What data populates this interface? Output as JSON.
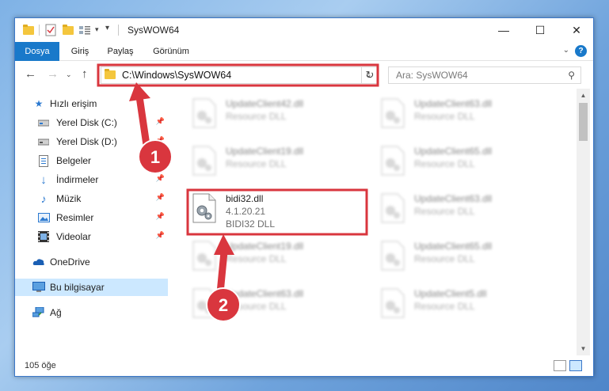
{
  "window": {
    "title": "SysWOW64",
    "controls": {
      "minimize": "—",
      "maximize": "☐",
      "close": "✕"
    }
  },
  "ribbon": {
    "tabs": [
      {
        "label": "Dosya",
        "active": true
      },
      {
        "label": "Giriş"
      },
      {
        "label": "Paylaş"
      },
      {
        "label": "Görünüm"
      }
    ],
    "help": "?"
  },
  "address": {
    "path": "C:\\Windows\\SysWOW64",
    "search_placeholder": "Ara: SysWOW64"
  },
  "nav": {
    "items": [
      {
        "label": "Hızlı erişim",
        "icon": "star-icon",
        "pinned": false
      },
      {
        "label": "Yerel Disk (C:)",
        "icon": "drive-icon",
        "pinned": true
      },
      {
        "label": "Yerel Disk (D:)",
        "icon": "drive-icon",
        "pinned": true
      },
      {
        "label": "Belgeler",
        "icon": "documents-icon",
        "pinned": true
      },
      {
        "label": "İndirmeler",
        "icon": "download-icon",
        "pinned": true
      },
      {
        "label": "Müzik",
        "icon": "music-icon",
        "pinned": true
      },
      {
        "label": "Resimler",
        "icon": "pictures-icon",
        "pinned": true
      },
      {
        "label": "Videolar",
        "icon": "videos-icon",
        "pinned": true
      },
      {
        "label": "OneDrive",
        "icon": "cloud-icon",
        "pinned": false
      },
      {
        "label": "Bu bilgisayar",
        "icon": "computer-icon",
        "pinned": false,
        "selected": true
      },
      {
        "label": "Ağ",
        "icon": "network-icon",
        "pinned": false
      }
    ]
  },
  "files": [
    {
      "name": "UpdateClient42.dll",
      "desc": "Resource DLL",
      "blurred": true
    },
    {
      "name": "UpdateClient63.dll",
      "desc": "Resource DLL",
      "blurred": true
    },
    {
      "name": "UpdateClient19.dll",
      "desc": "Resource DLL",
      "blurred": true
    },
    {
      "name": "UpdateClient65.dll",
      "desc": "Resource DLL",
      "blurred": true
    },
    {
      "name": "bidi32.dll",
      "version": "4.1.20.21",
      "desc": "BIDI32 DLL",
      "blurred": false,
      "highlighted": true
    },
    {
      "name": "UpdateClient63.dll",
      "desc": "Resource DLL",
      "blurred": true
    },
    {
      "name": "UpdateClient19.dll",
      "desc": "Resource DLL",
      "blurred": true
    },
    {
      "name": "UpdateClient65.dll",
      "desc": "Resource DLL",
      "blurred": true
    },
    {
      "name": "UpdateClient63.dll",
      "desc": "Resource DLL",
      "blurred": true
    },
    {
      "name": "UpdateClient5.dll",
      "desc": "Resource DLL",
      "blurred": true
    }
  ],
  "status": {
    "count": "105 öğe"
  },
  "annotations": {
    "step1": "1",
    "step2": "2",
    "color": "#d9363e"
  }
}
